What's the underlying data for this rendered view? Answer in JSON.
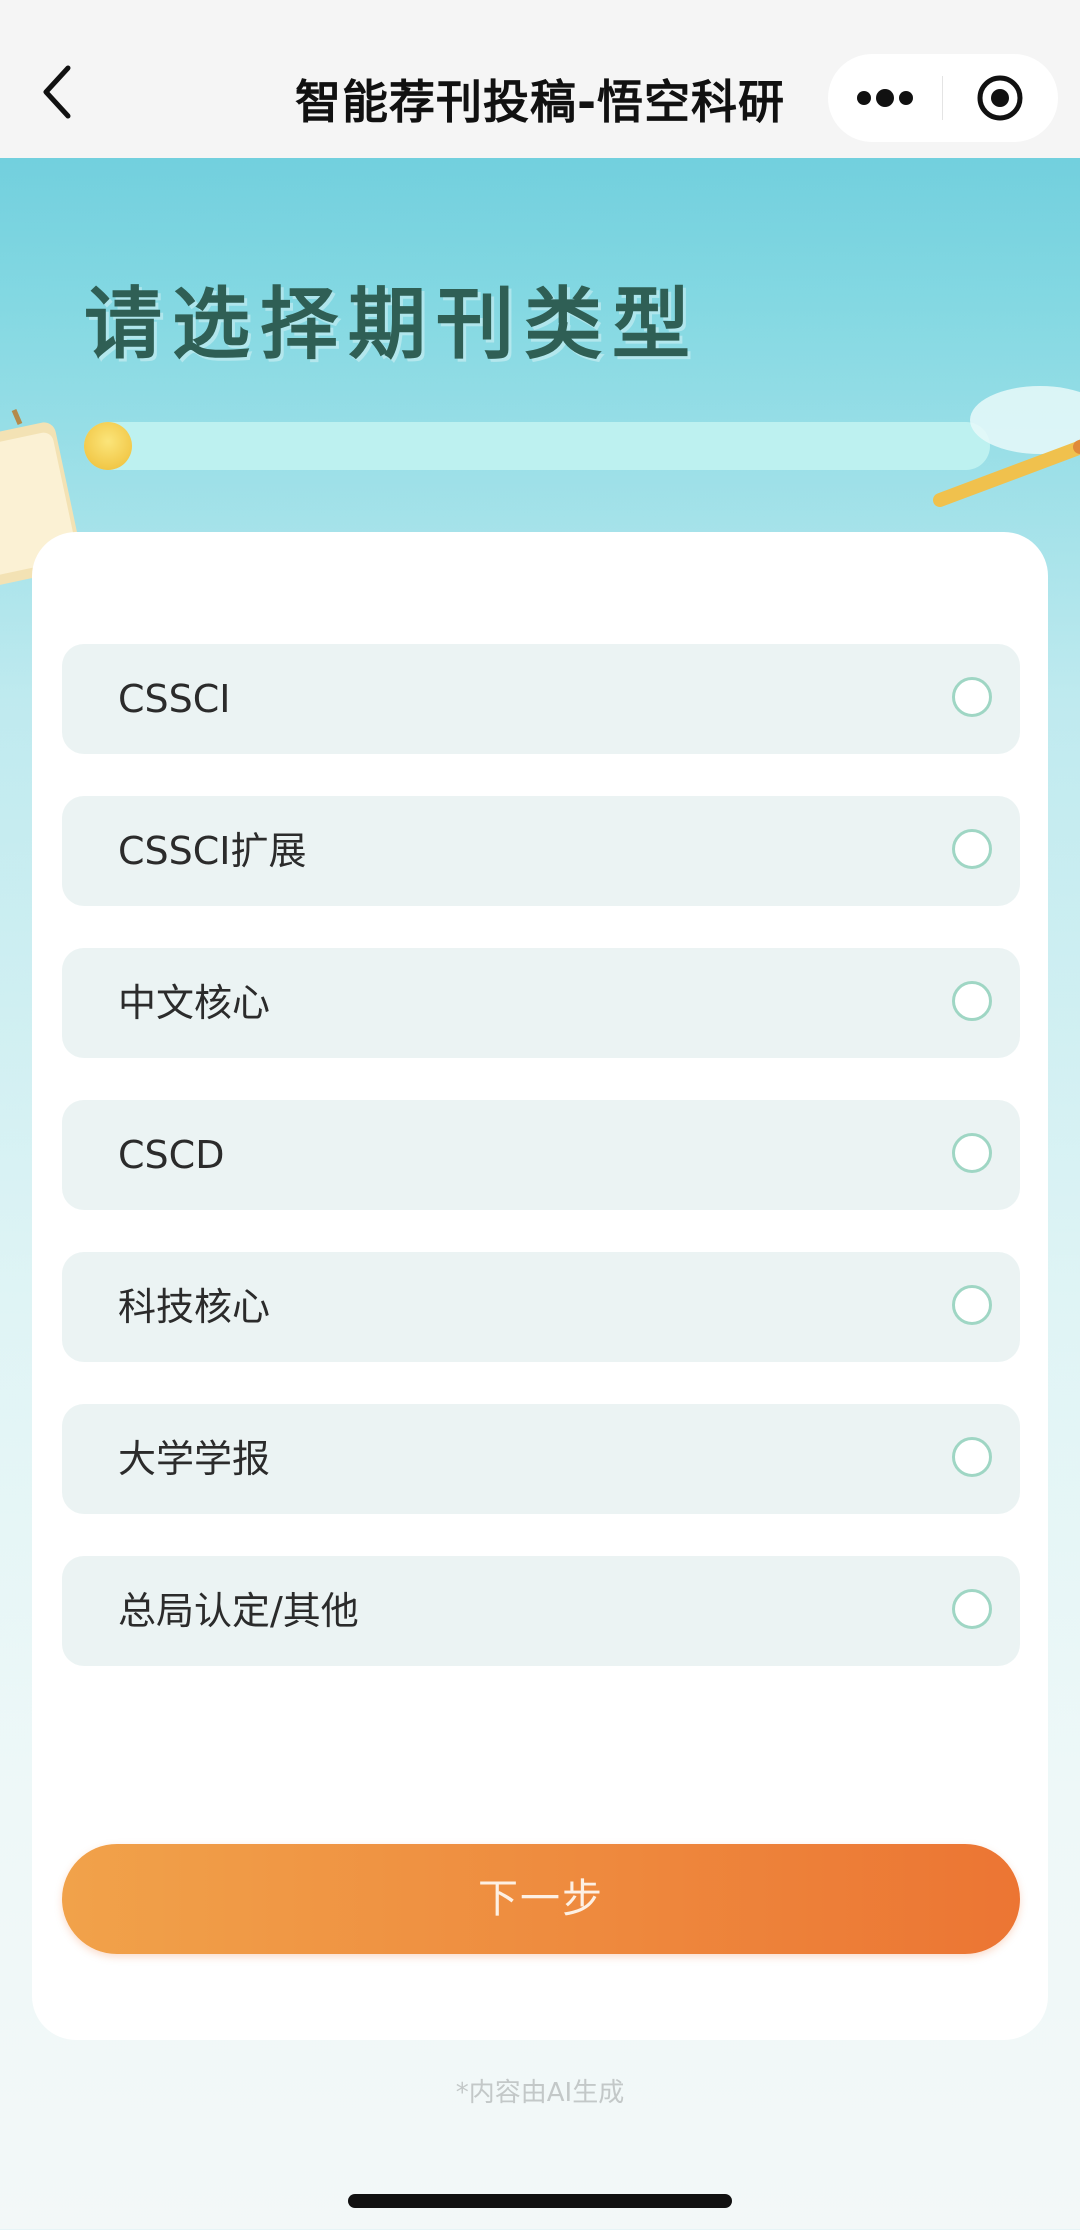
{
  "navbar": {
    "title": "智能荐刊投稿-悟空科研",
    "back_icon": "chevron-left-icon",
    "more_icon": "more-dots-icon",
    "close_icon": "target-circle-icon"
  },
  "hero": {
    "title": "请选择期刊类型",
    "progress_fraction": 0.03,
    "progress_color": "#f2c94a"
  },
  "options": [
    {
      "label": "CSSCI",
      "selected": false
    },
    {
      "label": "CSSCI扩展",
      "selected": false
    },
    {
      "label": "中文核心",
      "selected": false
    },
    {
      "label": "CSCD",
      "selected": false
    },
    {
      "label": "科技核心",
      "selected": false
    },
    {
      "label": "大学学报",
      "selected": false
    },
    {
      "label": "总局认定/其他",
      "selected": false
    }
  ],
  "next_button": {
    "label": "下一步",
    "color_start": "#f1a24a",
    "color_end": "#ec7533"
  },
  "footer": {
    "ai_note": "*内容由AI生成"
  },
  "colors": {
    "radio_border": "#9fd6c4",
    "option_bg": "#ebf3f3",
    "title_text": "#2f5f55"
  }
}
